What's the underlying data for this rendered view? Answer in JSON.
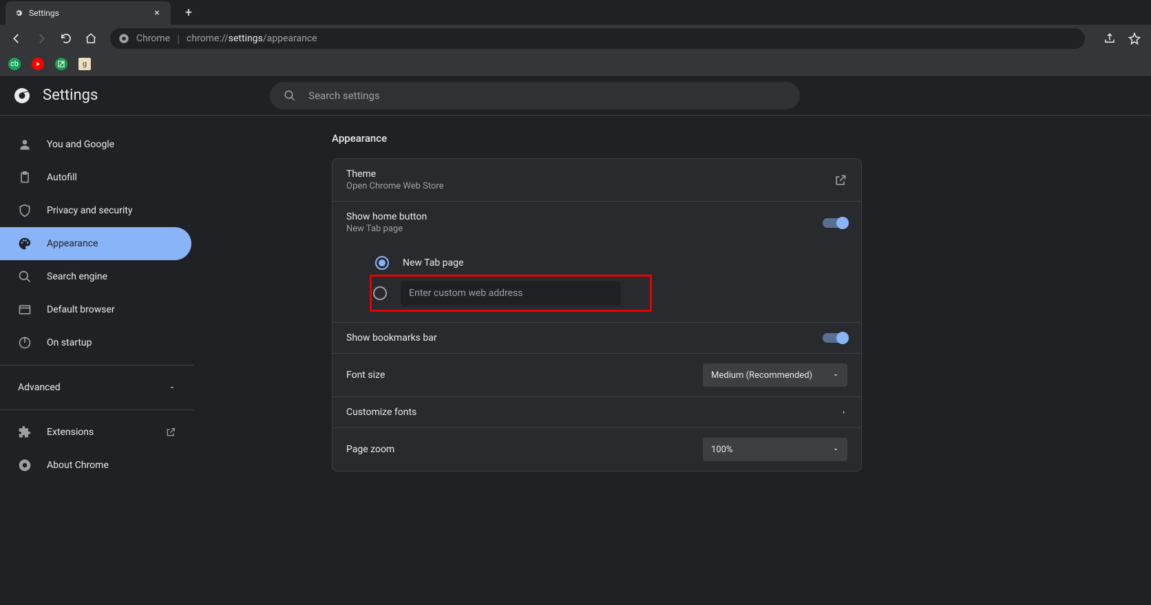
{
  "tab": {
    "title": "Settings"
  },
  "omnibox": {
    "prefix": "Chrome",
    "url_path": "chrome://",
    "url_bold": "settings",
    "url_suffix": "/appearance"
  },
  "settings_header": {
    "title": "Settings",
    "search_placeholder": "Search settings"
  },
  "sidebar": {
    "items": [
      {
        "label": "You and Google"
      },
      {
        "label": "Autofill"
      },
      {
        "label": "Privacy and security"
      },
      {
        "label": "Appearance"
      },
      {
        "label": "Search engine"
      },
      {
        "label": "Default browser"
      },
      {
        "label": "On startup"
      }
    ],
    "advanced": "Advanced",
    "extensions": "Extensions",
    "about": "About Chrome"
  },
  "content": {
    "section_title": "Appearance",
    "theme": {
      "title": "Theme",
      "sub": "Open Chrome Web Store"
    },
    "home": {
      "title": "Show home button",
      "sub": "New Tab page",
      "opt_newtab": "New Tab page",
      "custom_placeholder": "Enter custom web address"
    },
    "bookmarks": {
      "title": "Show bookmarks bar"
    },
    "font_size": {
      "title": "Font size",
      "value": "Medium (Recommended)"
    },
    "custom_fonts": {
      "title": "Customize fonts"
    },
    "zoom": {
      "title": "Page zoom",
      "value": "100%"
    }
  }
}
